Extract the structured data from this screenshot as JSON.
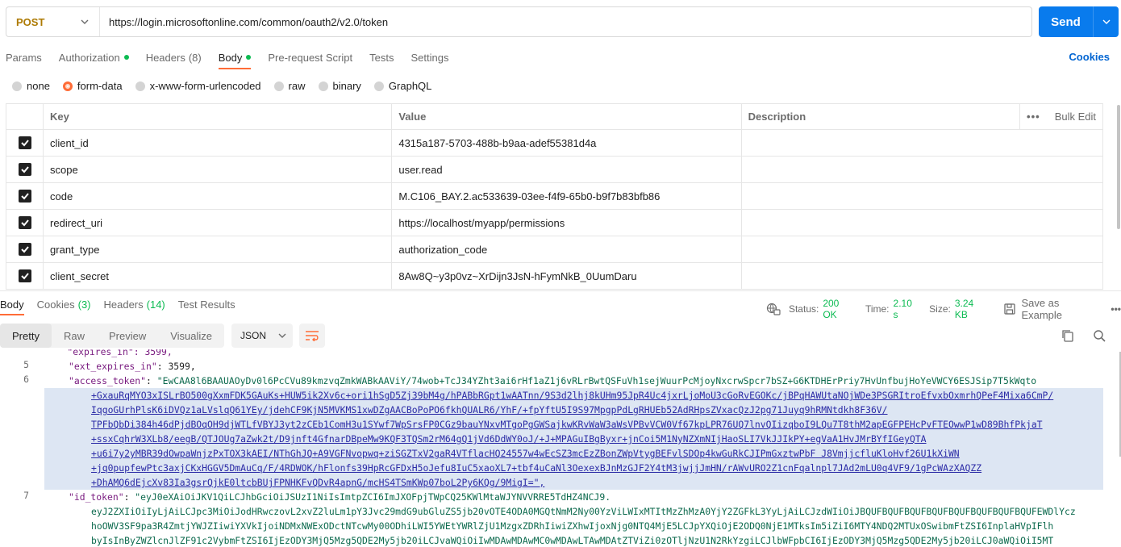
{
  "request": {
    "method": "POST",
    "url": "https://login.microsoftonline.com/common/oauth2/v2.0/token",
    "send_label": "Send"
  },
  "request_tabs": [
    {
      "label": "Params",
      "count": "",
      "dot": false
    },
    {
      "label": "Authorization",
      "count": "",
      "dot": true
    },
    {
      "label": "Headers",
      "count": "(8)",
      "dot": false
    },
    {
      "label": "Body",
      "count": "",
      "dot": true,
      "active": true
    },
    {
      "label": "Pre-request Script",
      "count": "",
      "dot": false
    },
    {
      "label": "Tests",
      "count": "",
      "dot": false
    },
    {
      "label": "Settings",
      "count": "",
      "dot": false
    }
  ],
  "cookies_label": "Cookies",
  "body_types": [
    {
      "label": "none",
      "selected": false
    },
    {
      "label": "form-data",
      "selected": true
    },
    {
      "label": "x-www-form-urlencoded",
      "selected": false
    },
    {
      "label": "raw",
      "selected": false
    },
    {
      "label": "binary",
      "selected": false
    },
    {
      "label": "GraphQL",
      "selected": false
    }
  ],
  "table": {
    "headers": {
      "key": "Key",
      "value": "Value",
      "description": "Description",
      "bulk_edit": "Bulk Edit",
      "more": "•••"
    },
    "rows": [
      {
        "key": "client_id",
        "value": "4315a187-5703-488b-b9aa-adef55381d4a"
      },
      {
        "key": "scope",
        "value": "user.read"
      },
      {
        "key": "code",
        "value": "M.C106_BAY.2.ac533639-03ee-f4f9-65b0-b9f7b83bfb86"
      },
      {
        "key": "redirect_uri",
        "value": "https://localhost/myapp/permissions"
      },
      {
        "key": "grant_type",
        "value": "authorization_code"
      },
      {
        "key": "client_secret",
        "value": "8Aw8Q~y3p0vz~XrDijn3JsN-hFymNkB_0UumDaru"
      }
    ]
  },
  "response_tabs": [
    {
      "label": "Body",
      "count": "",
      "active": true
    },
    {
      "label": "Cookies",
      "count": "(3)"
    },
    {
      "label": "Headers",
      "count": "(14)"
    },
    {
      "label": "Test Results",
      "count": ""
    }
  ],
  "response_status": {
    "status_label": "Status:",
    "status_value": "200 OK",
    "time_label": "Time:",
    "time_value": "2.10 s",
    "size_label": "Size:",
    "size_value": "3.24 KB",
    "save_label": "Save as Example",
    "more": "•••"
  },
  "format_tabs": [
    "Pretty",
    "Raw",
    "Preview",
    "Visualize"
  ],
  "format_selected": "Pretty",
  "language": "JSON",
  "code": {
    "line_numbers": [
      "5",
      "6",
      "7"
    ],
    "partial_top": "    \"expires_in\": 3599,",
    "ext_key": "\"ext_expires_in\"",
    "ext_value": "3599,",
    "access_key": "\"access_token\"",
    "access_lines": [
      "\"EwCAA8l6BAAUAOyDv0l6PcCVu89kmzvqZmkWABkAAViY/74wob+TcJ34YZht3ai6rHf1aZ1j6vRLrBwtQSFuVh1sejWuurPcMjoyNxcrwSpcr7bSZ+G6KTDHErPriy7HvUnfbujHoYeVWCY6ESJSip7T5kWqto",
      "+GxauRqMYO3xISLrBO500gXxmFDK5GAuKs+HUW5ik2Xv6c+ori1hSgD5Zj39bM4g/hPABbRGpt1wAATnn/9S3d2lhj8kUHm95JpR4Uc4jxrLjoMoU3cGoRvEGOKc/jBPqHAWUtaNOjWDe3PSGRItroEfvxbOxmrhQPeF4Mixa6CmP/",
      "IqgoGUrhPlsK6iDVQz1aLVslqQ61YEy/jdehCF9KjN5MVKMS1xwDZgAACBoPoPO6fkhQUALR6/YhF/+fpYftU5I9S97MpgpPdLgRHUEb52AdRHpsZVxacQzJ2pg71Juyq9hRMNtdkh8F36V/",
      "TPFbQbDi384h46dPjdBOqOH9djWTLfVBYJ3yt2zCEb1ComH3u1SYwf7WpSrsFP0CGz9bauYNxvMTgoPgGWSajkwKRvWaW3aWsVPBvVCW0Vf67kpLPR76UQ7lnvQIizqboI9LQu7T8thM2apEGFPEHcPvFTEOwwP1wD89BhfPkjaT",
      "+ssxCqhrW3XLb8/eegB/QTJOUg7aZwk2t/D9jnft4GfnarDBpeMw9KQF3TQSm2rM64gQ1jVd6DdWY0oJ/+J+MPAGuIBgByxr+jnCoi5M1NyNZXmNIjHaoSLI7VkJJIkPY+egVaA1HvJMrBYfIGeyQTA",
      "+u6i7y2yMBR39dOwpaWnjzPxTOX3kAEI/NThGhJQ+A9VGFNvopwq+ziSGZTxV2gaR4VTflacHQ24557w4wEcSZ3mcEzZBonZWpVtygBEFvlSDOp4kwGuRkCJIPmGxztwPbF J8VmjjcfluKloHvf26U1kXiWN",
      "+jq0pupfewPtc3axjCKxHGGV5DmAuCq/F/4RDWOK/hFlonfs39HpRcGFDxH5oJefu8IuC5xaoXL7+tbf4uCaNl3OexexBJnMzGJF2Y4tM3jwjjJmHN/rAWvURO2Z1cnFqalnpl7JAd2mLU0q4VF9/1gPcWAzXAQZZ",
      "+DhAMQ6dEjcXv83Ia3gsrQjkE0ltcbBUjFPNHKFvQDvR4apnG/mcHS4TSmKWp07boL2Py6KQg/9MigI=\","
    ],
    "id_key": "\"id_token\"",
    "id_lines": [
      "\"eyJ0eXAiOiJKV1QiLCJhbGciOiJSUzI1NiIsImtpZCI6ImJXOFpjTWpCQ25KWlMtaWJYNVVRRE5TdHZ4NCJ9.",
      "eyJ2ZXIiOiIyLjAiLCJpc3MiOiJodHRwczovL2xvZ2luLm1pY3Jvc29mdG9ubGluZS5jb20vOTE4ODA0MGQtNmM2Ny00YzViLWIxMTItMzZhMzA0YjY2ZGFkL3YyLjAiLCJzdWIiOiJBQUFBQUFBQUFBQUFBQUFBQUFBQUFBQUFEWDlYcz",
      "hoOWV3SF9pa3R4ZmtjYWJZIiwiYXVkIjoiNDMxNWExODctNTcwMy00ODhiLWI5YWEtYWRlZjU1MzgxZDRhIiwiZXhwIjoxNjg0NTQ4MjE5LCJpYXQiOjE2ODQ0NjE1MTksIm5iZiI6MTY4NDQ2MTUxOSwibmFtZSI6InplaHVpIFlh",
      "byIsInByZWZlcnJlZF91c2VybmFtZSI6IjEzODY3MjQ5Mzg5QDE2My5jb20iLCJvaWQiOiIwMDAwMDAwMC0wMDAwLTAwMDAtZTViZi0zOTljNzU1N2RkYzgiLCJlbWFpbCI6IjEzODY3MjQ5Mzg5QDE2My5jb20iLCJ0aWQiOiI5MT"
    ]
  }
}
